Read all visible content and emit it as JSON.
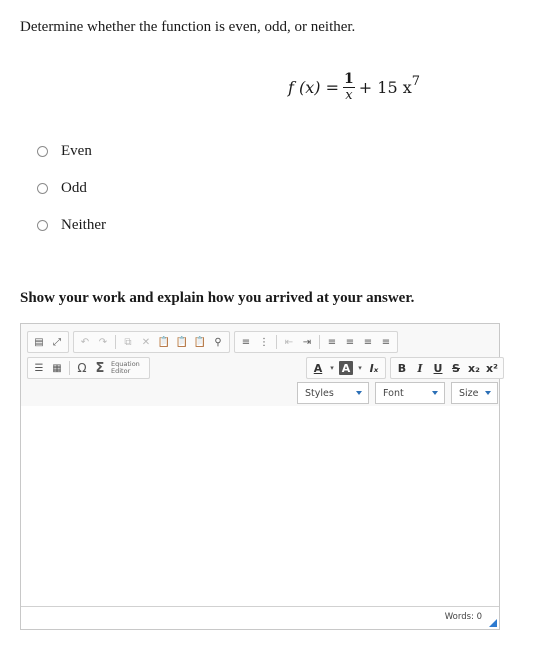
{
  "question": {
    "text": "Determine whether the function is even, odd, or neither."
  },
  "formula": {
    "lhs": "f (x) =",
    "numerator": "1",
    "denominator": "x",
    "rest": "+ 15 x",
    "exponent": "7"
  },
  "options": [
    {
      "label": "Even"
    },
    {
      "label": "Odd"
    },
    {
      "label": "Neither"
    }
  ],
  "prompt": {
    "text": "Show your work and explain how you arrived at your answer."
  },
  "editor": {
    "toolbar": {
      "equation_editor_label": "Equation Editor",
      "styles_label": "Styles",
      "font_label": "Font",
      "size_label": "Size"
    },
    "status": {
      "words": "Words: 0"
    }
  }
}
